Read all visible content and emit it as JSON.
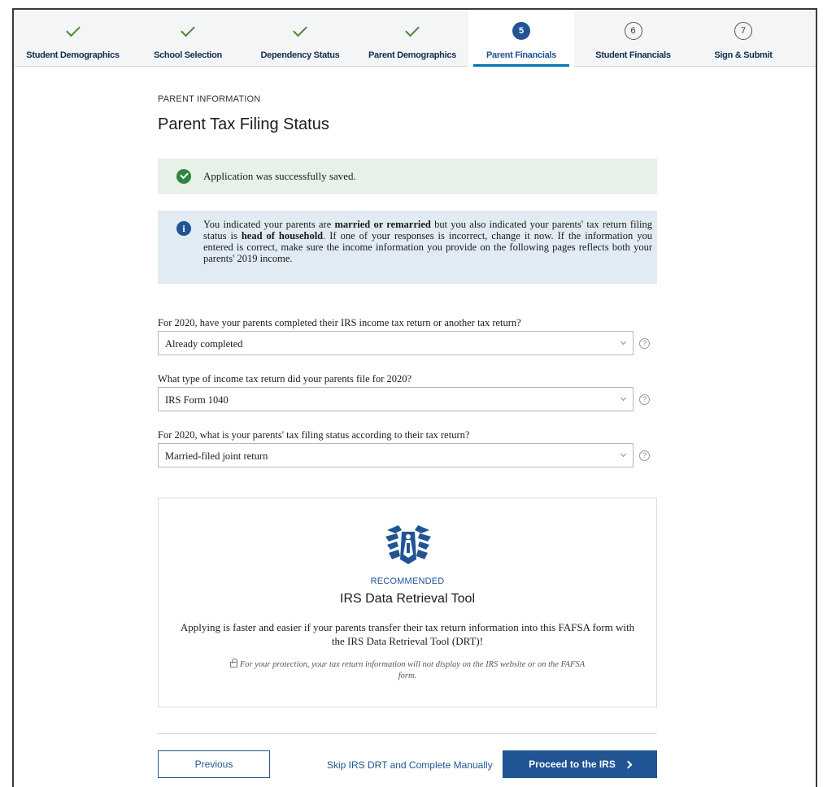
{
  "steps": [
    {
      "label": "Student Demographics",
      "state": "done",
      "icon": "check-icon"
    },
    {
      "label": "School Selection",
      "state": "done",
      "icon": "check-icon"
    },
    {
      "label": "Dependency Status",
      "state": "done",
      "icon": "check-icon"
    },
    {
      "label": "Parent Demographics",
      "state": "done",
      "icon": "check-icon"
    },
    {
      "label": "Parent Financials",
      "state": "active",
      "number": "5"
    },
    {
      "label": "Student Financials",
      "state": "pending",
      "number": "6"
    },
    {
      "label": "Sign & Submit",
      "state": "pending",
      "number": "7"
    }
  ],
  "page": {
    "eyebrow": "PARENT INFORMATION",
    "title": "Parent Tax Filing Status"
  },
  "alerts": {
    "success": "Application was successfully saved.",
    "info_parts": [
      "You indicated your parents are ",
      "married or remarried",
      " but you also indicated your parents' tax return filing status is ",
      "head of household",
      ". If one of your responses is incorrect, change it now. If the information you entered is correct, make sure the income information you provide on the following pages reflects both your parents' 2019 income."
    ]
  },
  "questions": [
    {
      "label": "For 2020, have your parents completed their IRS income tax return or another tax return?",
      "value": "Already completed"
    },
    {
      "label": "What type of income tax return did your parents file for 2020?",
      "value": "IRS Form 1040"
    },
    {
      "label": "For 2020, what is your parents' tax filing status according to their tax return?",
      "value": "Married-filed joint return"
    }
  ],
  "help_glyph": "?",
  "drt": {
    "eyebrow": "RECOMMENDED",
    "title": "IRS Data Retrieval Tool",
    "description": "Applying is faster and easier if your parents transfer their tax return information into this FAFSA form with the IRS Data Retrieval Tool (DRT)!",
    "note": "For your protection, your tax return information will not display on the IRS website or on the FAFSA form."
  },
  "footer": {
    "previous_label": "Previous",
    "skip_label": "Skip IRS DRT and Complete Manually",
    "proceed_label": "Proceed to the IRS"
  },
  "colors": {
    "primary": "#205493",
    "success_bg": "#e7f1e7",
    "info_bg": "#e1ebf4",
    "check": "#4d8a3d"
  }
}
